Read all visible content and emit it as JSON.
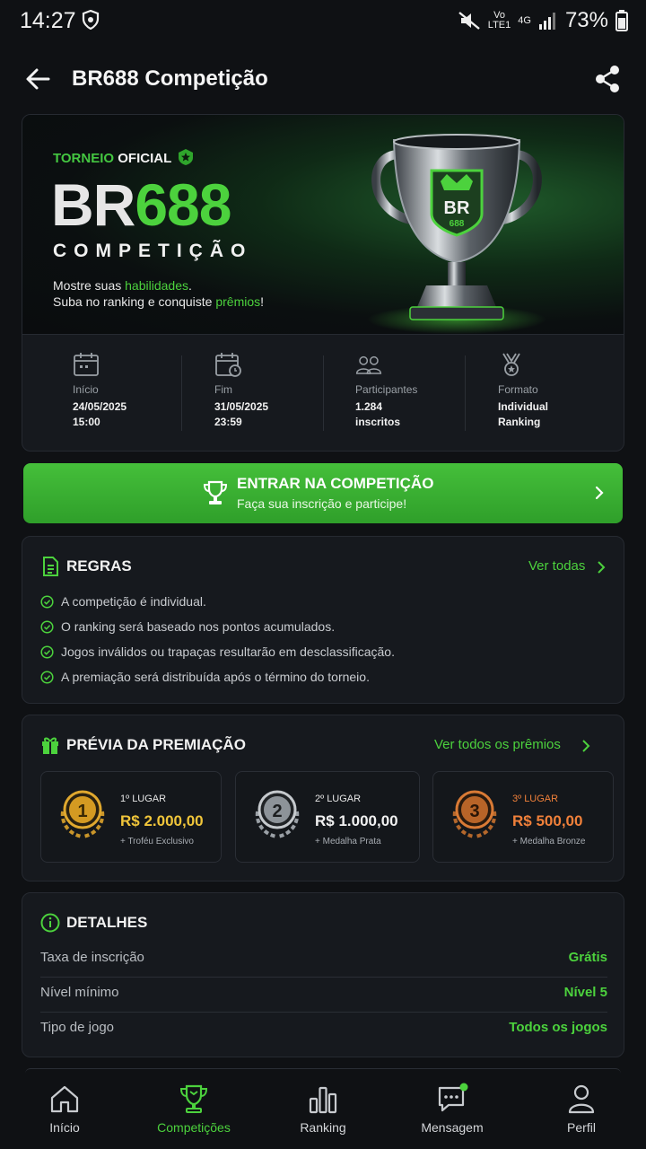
{
  "status_bar": {
    "time": "14:27",
    "net_top": "Vo",
    "net_bottom": "LTE1",
    "signal_gen": "4G",
    "battery": "73%"
  },
  "header": {
    "title": "BR688 Competição",
    "back_icon": "arrow-left-icon",
    "share_icon": "share-icon"
  },
  "hero": {
    "tag_green": "TORNEIO",
    "tag_white": " OFICIAL",
    "brand_white": "BR",
    "brand_green": "688",
    "subtitle": "COMPETIÇÃO",
    "line1_pre": "Mostre suas ",
    "line1_hl": "habilidades",
    "line1_post": ".",
    "line2_pre": "Suba no ranking e conquiste ",
    "line2_hl": "prêmios",
    "line2_post": "!",
    "trophy_text": "BR",
    "trophy_sub": "688"
  },
  "info": [
    {
      "icon": "calendar-icon",
      "label": "Início",
      "line1": "24/05/2025",
      "line2": "15:00"
    },
    {
      "icon": "calendar-clock-icon",
      "label": "Fim",
      "line1": "31/05/2025",
      "line2": "23:59"
    },
    {
      "icon": "users-icon",
      "label": "Participantes",
      "line1": "1.284",
      "line2": "inscritos"
    },
    {
      "icon": "medal-ribbon-icon",
      "label": "Formato",
      "line1": "Individual",
      "line2": "Ranking"
    }
  ],
  "cta": {
    "title": "ENTRAR NA COMPETIÇÃO",
    "subtitle": "Faça sua inscrição e participe!"
  },
  "rules": {
    "title": "REGRAS",
    "link": "Ver todas",
    "items": [
      "A competição é individual.",
      "O ranking será baseado nos pontos acumulados.",
      "Jogos inválidos ou trapaças resultarão em desclassificação.",
      "A premiação será distribuída após o término do torneio."
    ]
  },
  "prizes": {
    "title": "PRÉVIA DA PREMIAÇÃO",
    "link": "Ver todos os prêmios",
    "items": [
      {
        "rank": "1",
        "place": "1º LUGAR",
        "amount": "R$ 2.000,00",
        "extra": "+ Troféu Exclusivo",
        "color": "#f0c53a"
      },
      {
        "rank": "2",
        "place": "2º LUGAR",
        "amount": "R$ 1.000,00",
        "extra": "+ Medalha Prata",
        "color": "#f1f1f1"
      },
      {
        "rank": "3",
        "place": "3º LUGAR",
        "amount": "R$ 500,00",
        "extra": "+ Medalha Bronze",
        "color": "#f0803a"
      }
    ]
  },
  "details": {
    "title": "DETALHES",
    "rows": [
      {
        "key": "Taxa de inscrição",
        "value": "Grátis"
      },
      {
        "key": "Nível mínimo",
        "value": "Nível 5"
      },
      {
        "key": "Tipo de jogo",
        "value": "Todos os jogos"
      }
    ]
  },
  "nav": [
    {
      "label": "Início",
      "icon": "home-icon",
      "active": false
    },
    {
      "label": "Competições",
      "icon": "trophy-icon",
      "active": true
    },
    {
      "label": "Ranking",
      "icon": "bar-chart-icon",
      "active": false
    },
    {
      "label": "Mensagem",
      "icon": "chat-icon",
      "active": false
    },
    {
      "label": "Perfil",
      "icon": "user-icon",
      "active": false
    }
  ],
  "colors": {
    "accent": "#4cd23d",
    "background": "#0f1114",
    "card": "#16191e",
    "cta": "#3fb536"
  }
}
